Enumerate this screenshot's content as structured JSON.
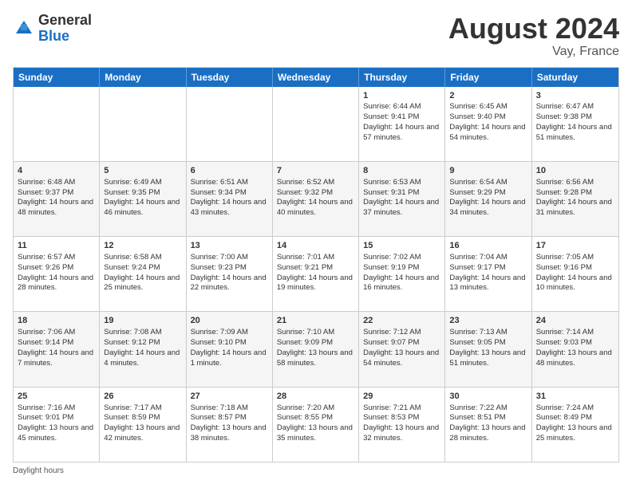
{
  "header": {
    "logo_general": "General",
    "logo_blue": "Blue",
    "month_title": "August 2024",
    "location": "Vay, France"
  },
  "weekdays": [
    "Sunday",
    "Monday",
    "Tuesday",
    "Wednesday",
    "Thursday",
    "Friday",
    "Saturday"
  ],
  "footer": {
    "daylight_label": "Daylight hours"
  },
  "weeks": [
    [
      {
        "day": "",
        "info": ""
      },
      {
        "day": "",
        "info": ""
      },
      {
        "day": "",
        "info": ""
      },
      {
        "day": "",
        "info": ""
      },
      {
        "day": "1",
        "info": "Sunrise: 6:44 AM\nSunset: 9:41 PM\nDaylight: 14 hours and 57 minutes."
      },
      {
        "day": "2",
        "info": "Sunrise: 6:45 AM\nSunset: 9:40 PM\nDaylight: 14 hours and 54 minutes."
      },
      {
        "day": "3",
        "info": "Sunrise: 6:47 AM\nSunset: 9:38 PM\nDaylight: 14 hours and 51 minutes."
      }
    ],
    [
      {
        "day": "4",
        "info": "Sunrise: 6:48 AM\nSunset: 9:37 PM\nDaylight: 14 hours and 48 minutes."
      },
      {
        "day": "5",
        "info": "Sunrise: 6:49 AM\nSunset: 9:35 PM\nDaylight: 14 hours and 46 minutes."
      },
      {
        "day": "6",
        "info": "Sunrise: 6:51 AM\nSunset: 9:34 PM\nDaylight: 14 hours and 43 minutes."
      },
      {
        "day": "7",
        "info": "Sunrise: 6:52 AM\nSunset: 9:32 PM\nDaylight: 14 hours and 40 minutes."
      },
      {
        "day": "8",
        "info": "Sunrise: 6:53 AM\nSunset: 9:31 PM\nDaylight: 14 hours and 37 minutes."
      },
      {
        "day": "9",
        "info": "Sunrise: 6:54 AM\nSunset: 9:29 PM\nDaylight: 14 hours and 34 minutes."
      },
      {
        "day": "10",
        "info": "Sunrise: 6:56 AM\nSunset: 9:28 PM\nDaylight: 14 hours and 31 minutes."
      }
    ],
    [
      {
        "day": "11",
        "info": "Sunrise: 6:57 AM\nSunset: 9:26 PM\nDaylight: 14 hours and 28 minutes."
      },
      {
        "day": "12",
        "info": "Sunrise: 6:58 AM\nSunset: 9:24 PM\nDaylight: 14 hours and 25 minutes."
      },
      {
        "day": "13",
        "info": "Sunrise: 7:00 AM\nSunset: 9:23 PM\nDaylight: 14 hours and 22 minutes."
      },
      {
        "day": "14",
        "info": "Sunrise: 7:01 AM\nSunset: 9:21 PM\nDaylight: 14 hours and 19 minutes."
      },
      {
        "day": "15",
        "info": "Sunrise: 7:02 AM\nSunset: 9:19 PM\nDaylight: 14 hours and 16 minutes."
      },
      {
        "day": "16",
        "info": "Sunrise: 7:04 AM\nSunset: 9:17 PM\nDaylight: 14 hours and 13 minutes."
      },
      {
        "day": "17",
        "info": "Sunrise: 7:05 AM\nSunset: 9:16 PM\nDaylight: 14 hours and 10 minutes."
      }
    ],
    [
      {
        "day": "18",
        "info": "Sunrise: 7:06 AM\nSunset: 9:14 PM\nDaylight: 14 hours and 7 minutes."
      },
      {
        "day": "19",
        "info": "Sunrise: 7:08 AM\nSunset: 9:12 PM\nDaylight: 14 hours and 4 minutes."
      },
      {
        "day": "20",
        "info": "Sunrise: 7:09 AM\nSunset: 9:10 PM\nDaylight: 14 hours and 1 minute."
      },
      {
        "day": "21",
        "info": "Sunrise: 7:10 AM\nSunset: 9:09 PM\nDaylight: 13 hours and 58 minutes."
      },
      {
        "day": "22",
        "info": "Sunrise: 7:12 AM\nSunset: 9:07 PM\nDaylight: 13 hours and 54 minutes."
      },
      {
        "day": "23",
        "info": "Sunrise: 7:13 AM\nSunset: 9:05 PM\nDaylight: 13 hours and 51 minutes."
      },
      {
        "day": "24",
        "info": "Sunrise: 7:14 AM\nSunset: 9:03 PM\nDaylight: 13 hours and 48 minutes."
      }
    ],
    [
      {
        "day": "25",
        "info": "Sunrise: 7:16 AM\nSunset: 9:01 PM\nDaylight: 13 hours and 45 minutes."
      },
      {
        "day": "26",
        "info": "Sunrise: 7:17 AM\nSunset: 8:59 PM\nDaylight: 13 hours and 42 minutes."
      },
      {
        "day": "27",
        "info": "Sunrise: 7:18 AM\nSunset: 8:57 PM\nDaylight: 13 hours and 38 minutes."
      },
      {
        "day": "28",
        "info": "Sunrise: 7:20 AM\nSunset: 8:55 PM\nDaylight: 13 hours and 35 minutes."
      },
      {
        "day": "29",
        "info": "Sunrise: 7:21 AM\nSunset: 8:53 PM\nDaylight: 13 hours and 32 minutes."
      },
      {
        "day": "30",
        "info": "Sunrise: 7:22 AM\nSunset: 8:51 PM\nDaylight: 13 hours and 28 minutes."
      },
      {
        "day": "31",
        "info": "Sunrise: 7:24 AM\nSunset: 8:49 PM\nDaylight: 13 hours and 25 minutes."
      }
    ]
  ]
}
